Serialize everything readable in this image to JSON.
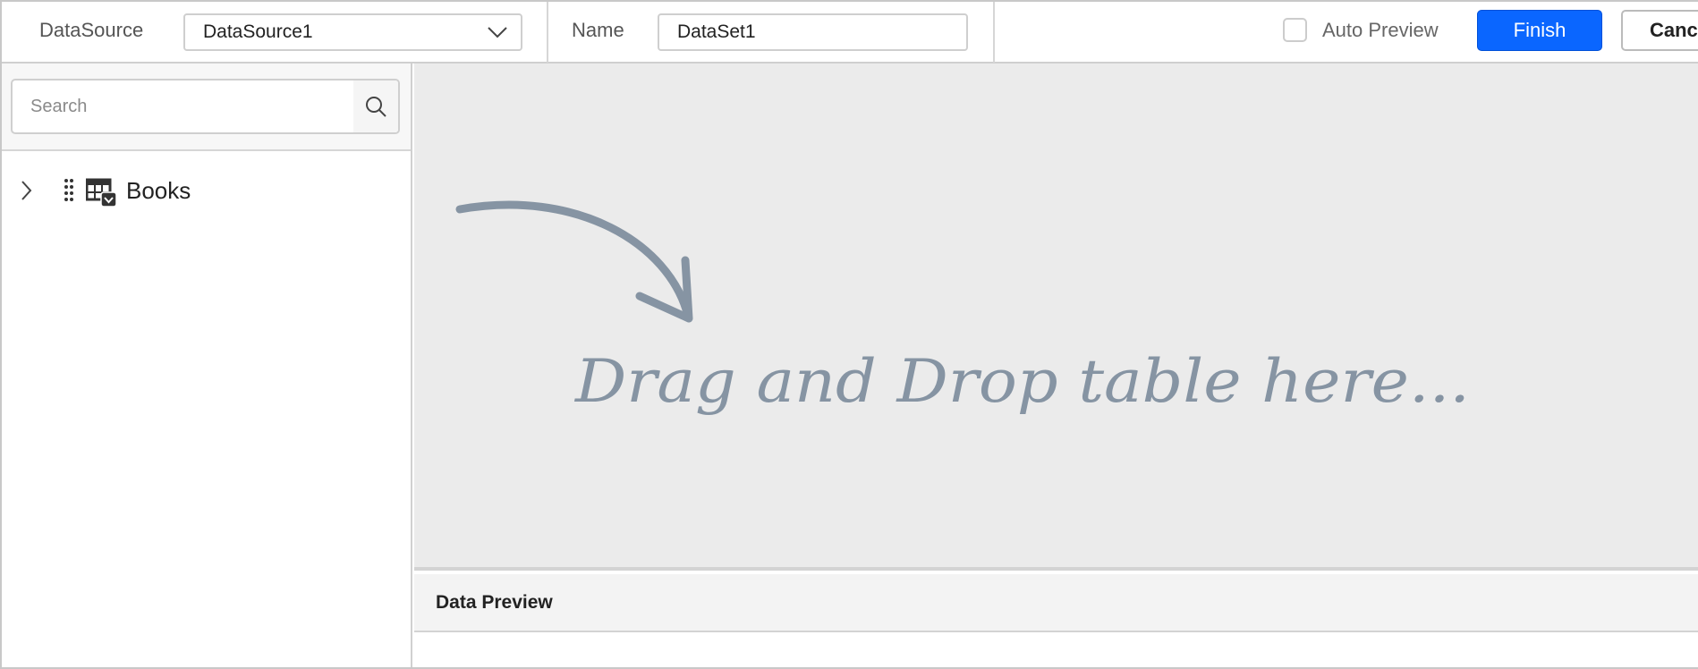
{
  "header": {
    "datasource_label": "DataSource",
    "datasource_value": "DataSource1",
    "name_label": "Name",
    "name_value": "DataSet1",
    "auto_preview_label": "Auto Preview",
    "auto_preview_checked": false,
    "finish_label": "Finish",
    "cancel_label": "Canc"
  },
  "sidebar": {
    "search_placeholder": "Search",
    "tree": [
      {
        "label": "Books",
        "icon": "table-icon"
      }
    ]
  },
  "canvas": {
    "drop_hint": "Drag and Drop table here..."
  },
  "preview": {
    "title": "Data Preview"
  },
  "colors": {
    "accent": "#0a66ff",
    "hint": "#8694a3",
    "canvas_bg": "#ebebeb"
  }
}
